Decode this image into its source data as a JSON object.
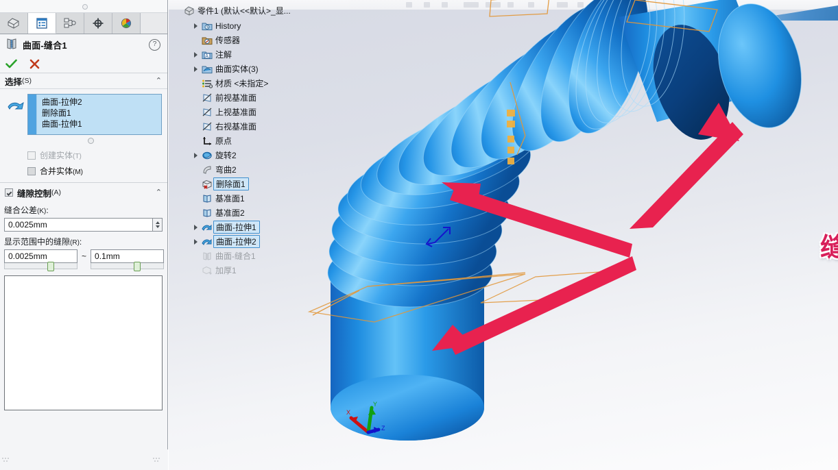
{
  "window": {
    "app": "SolidWorks",
    "document_title": "零件1"
  },
  "property_manager": {
    "tabs": [
      {
        "name": "feature-manager",
        "icon": "feature-tree-icon",
        "active": false
      },
      {
        "name": "property-manager",
        "icon": "property-list-icon",
        "active": true
      },
      {
        "name": "configuration-manager",
        "icon": "configuration-icon",
        "active": false
      },
      {
        "name": "dimxpert-manager",
        "icon": "dimxpert-target-icon",
        "active": false
      },
      {
        "name": "display-manager",
        "icon": "display-appearance-icon",
        "active": false
      }
    ],
    "title": "曲面-缝合1",
    "title_icon": "knit-surface-icon",
    "help_glyph": "?",
    "ok_label": "✔",
    "cancel_label": "✘",
    "selection_section": {
      "title": "选择",
      "hotkey": "(S)",
      "collapse_glyph": "⌃",
      "items": [
        "曲面-拉伸2",
        "删除面1",
        "曲面-拉伸1"
      ],
      "checkboxes": [
        {
          "label": "创建实体",
          "hotkey": "(T)",
          "checked": false,
          "enabled": false
        },
        {
          "label": "合并实体",
          "hotkey": "(M)",
          "checked": false,
          "enabled": true
        }
      ]
    },
    "gap_section": {
      "title": "缝隙控制",
      "hotkey": "(A)",
      "enabled": true,
      "collapse_glyph": "⌃",
      "tolerance_label": "缝合公差",
      "tolerance_hotkey": "(K)",
      "tolerance_value": "0.0025mm",
      "range_label": "显示范围中的缝隙",
      "range_hotkey": "(R)",
      "range_min": "0.0025mm",
      "range_max": "0.1mm",
      "range_separator": "~",
      "gap_list_items": []
    }
  },
  "feature_tree": {
    "root": {
      "label": "零件1  (默认<<默认>_显...",
      "icon": "part-icon"
    },
    "nodes": [
      {
        "label": "History",
        "icon": "history-icon",
        "expandable": true,
        "indent": 1,
        "state": "normal"
      },
      {
        "label": "传感器",
        "icon": "sensor-icon",
        "expandable": false,
        "indent": 1,
        "state": "normal"
      },
      {
        "label": "注解",
        "icon": "annotation-icon",
        "expandable": true,
        "indent": 1,
        "state": "normal"
      },
      {
        "label": "曲面实体(3)",
        "icon": "surface-bodies-icon",
        "expandable": true,
        "indent": 1,
        "state": "normal"
      },
      {
        "label": "材质 <未指定>",
        "icon": "material-icon",
        "expandable": false,
        "indent": 1,
        "state": "normal"
      },
      {
        "label": "前视基准面",
        "icon": "plane-icon",
        "expandable": false,
        "indent": 1,
        "state": "normal"
      },
      {
        "label": "上视基准面",
        "icon": "plane-icon",
        "expandable": false,
        "indent": 1,
        "state": "normal"
      },
      {
        "label": "右视基准面",
        "icon": "plane-icon",
        "expandable": false,
        "indent": 1,
        "state": "normal"
      },
      {
        "label": "原点",
        "icon": "origin-icon",
        "expandable": false,
        "indent": 1,
        "state": "normal"
      },
      {
        "label": "旋转2",
        "icon": "revolve-icon",
        "expandable": true,
        "indent": 1,
        "state": "normal"
      },
      {
        "label": "弯曲2",
        "icon": "flex-icon",
        "expandable": false,
        "indent": 1,
        "state": "normal"
      },
      {
        "label": "删除面1",
        "icon": "delete-face-icon",
        "expandable": false,
        "indent": 1,
        "state": "selected"
      },
      {
        "label": "基准面1",
        "icon": "plane-feature-icon",
        "expandable": false,
        "indent": 1,
        "state": "normal"
      },
      {
        "label": "基准面2",
        "icon": "plane-feature-icon",
        "expandable": false,
        "indent": 1,
        "state": "normal"
      },
      {
        "label": "曲面-拉伸1",
        "icon": "surface-extrude-icon",
        "expandable": true,
        "indent": 1,
        "state": "selected"
      },
      {
        "label": "曲面-拉伸2",
        "icon": "surface-extrude-icon",
        "expandable": true,
        "indent": 1,
        "state": "selected"
      },
      {
        "label": "曲面-缝合1",
        "icon": "knit-surface-icon",
        "expandable": false,
        "indent": 1,
        "state": "dimmed"
      },
      {
        "label": "加厚1",
        "icon": "thicken-icon",
        "expandable": false,
        "indent": 1,
        "state": "dimmed"
      }
    ]
  },
  "viewport": {
    "annotation": {
      "text": "缝合曲面",
      "color": "#d81f5a",
      "outline_color": "#ffffff",
      "arrow_count": 3
    },
    "model": {
      "description": "corrugated bellows duct",
      "primary_color": "#1f8ae0",
      "highlight_color": "#7cc8f5",
      "shadow_color": "#0c4f92"
    },
    "triad": {
      "x_label": "X",
      "x_color": "#cc1111",
      "y_label": "Y",
      "y_color": "#12a012",
      "z_label": "Z",
      "z_color": "#1111cc"
    },
    "background": {
      "top": "#d7dae4",
      "bottom": "#fcfcfd"
    }
  }
}
